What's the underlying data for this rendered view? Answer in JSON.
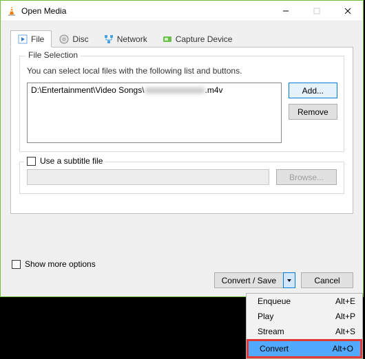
{
  "window": {
    "title": "Open Media"
  },
  "tabs": {
    "file": "File",
    "disc": "Disc",
    "network": "Network",
    "capture": "Capture Device"
  },
  "file_selection": {
    "group_title": "File Selection",
    "hint": "You can select local files with the following list and buttons.",
    "entry_prefix": "D:\\Entertainment\\Video Songs\\",
    "entry_suffix": ".m4v",
    "add": "Add...",
    "remove": "Remove"
  },
  "subtitle": {
    "label": "Use a subtitle file",
    "browse": "Browse..."
  },
  "more_options": "Show more options",
  "actions": {
    "convert_save": "Convert / Save",
    "cancel": "Cancel"
  },
  "menu": {
    "items": [
      {
        "label": "Enqueue",
        "shortcut": "Alt+E"
      },
      {
        "label": "Play",
        "shortcut": "Alt+P"
      },
      {
        "label": "Stream",
        "shortcut": "Alt+S"
      },
      {
        "label": "Convert",
        "shortcut": "Alt+O"
      }
    ]
  }
}
